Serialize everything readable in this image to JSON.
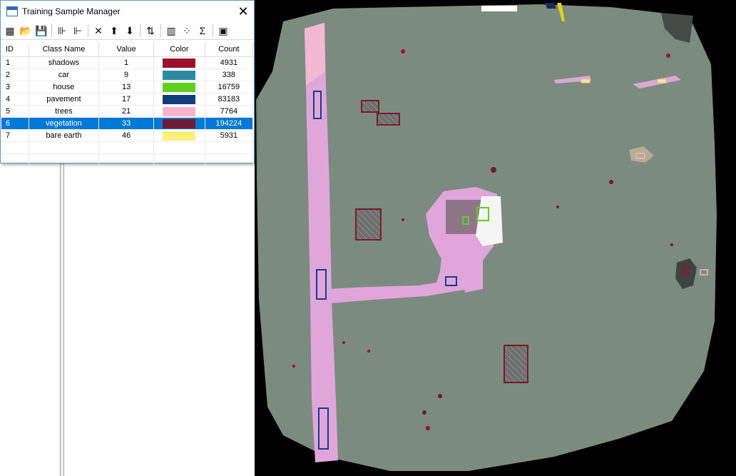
{
  "window": {
    "title": "Training Sample Manager",
    "close_glyph": "✕"
  },
  "toolbar": {
    "buttons": [
      {
        "name": "remove-class-icon",
        "glyph": "▦"
      },
      {
        "name": "open-folder-icon",
        "glyph": "📂"
      },
      {
        "name": "save-icon",
        "glyph": "💾"
      },
      {
        "name": "merge-classes-icon",
        "glyph": "⊪"
      },
      {
        "name": "split-class-icon",
        "glyph": "⊩"
      },
      {
        "name": "delete-icon",
        "glyph": "✕"
      },
      {
        "name": "move-up-icon",
        "glyph": "⬆"
      },
      {
        "name": "move-down-icon",
        "glyph": "⬇"
      },
      {
        "name": "sort-icon",
        "glyph": "⇅"
      },
      {
        "name": "histogram-icon",
        "glyph": "▥"
      },
      {
        "name": "scatterplot-icon",
        "glyph": "⁘"
      },
      {
        "name": "statistics-icon",
        "glyph": "Σ"
      },
      {
        "name": "signature-icon",
        "glyph": "▣"
      }
    ]
  },
  "table": {
    "headers": [
      "ID",
      "Class Name",
      "Value",
      "Color",
      "Count"
    ],
    "rows": [
      {
        "id": "1",
        "name": "shadows",
        "value": "1",
        "color": "#9c0f2e",
        "count": "4931"
      },
      {
        "id": "2",
        "name": "car",
        "value": "9",
        "color": "#2e8aa0",
        "count": "338"
      },
      {
        "id": "3",
        "name": "house",
        "value": "13",
        "color": "#5fd11d",
        "count": "16759"
      },
      {
        "id": "4",
        "name": "pavement",
        "value": "17",
        "color": "#0e3f7c",
        "count": "83183"
      },
      {
        "id": "5",
        "name": "trees",
        "value": "21",
        "color": "#f6b3c9",
        "count": "7764"
      },
      {
        "id": "6",
        "name": "vegetation",
        "value": "33",
        "color": "#6f1a35",
        "count": "194224"
      },
      {
        "id": "7",
        "name": "bare earth",
        "value": "46",
        "color": "#faf07a",
        "count": "5931"
      }
    ],
    "selected_row": 5
  },
  "colors": {
    "map_ground": "#7b8b80",
    "road": "#e0a6da",
    "sample_outline_shadow": "#7b1a2c",
    "sample_outline_pavement": "#163d8a",
    "sample_outline_house": "#5fd11d",
    "selection": "#0078d7"
  }
}
